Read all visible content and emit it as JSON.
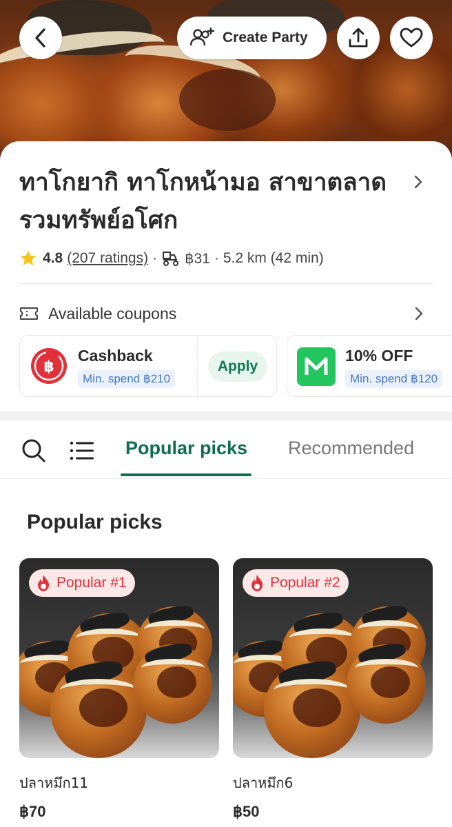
{
  "header": {
    "create_party_label": "Create Party"
  },
  "store": {
    "name": "ทาโกยากิ ทาโกหน้ามอ สาขาตลาดรวมทรัพย์อโศก",
    "rating": "4.8",
    "ratings_count": "(207 ratings)",
    "delivery_fee": "฿31",
    "distance_time": "5.2 km (42 min)"
  },
  "coupons": {
    "section_label": "Available coupons",
    "items": [
      {
        "title": "Cashback",
        "min_spend": "Min. spend ฿210",
        "action": "Apply"
      },
      {
        "title": "10% OFF",
        "min_spend": "Min. spend ฿120"
      }
    ]
  },
  "tabs": {
    "items": [
      "Popular picks",
      "Recommended"
    ],
    "active": "Popular picks"
  },
  "popular": {
    "title": "Popular picks",
    "items": [
      {
        "badge": "Popular #1",
        "name": "ปลาหมึก11",
        "price": "฿70"
      },
      {
        "badge": "Popular #2",
        "name": "ปลาหมึก6",
        "price": "฿50"
      }
    ]
  },
  "colors": {
    "brand_green": "#0f6e50",
    "popular_red": "#e2303a",
    "star_yellow": "#f5c518"
  }
}
